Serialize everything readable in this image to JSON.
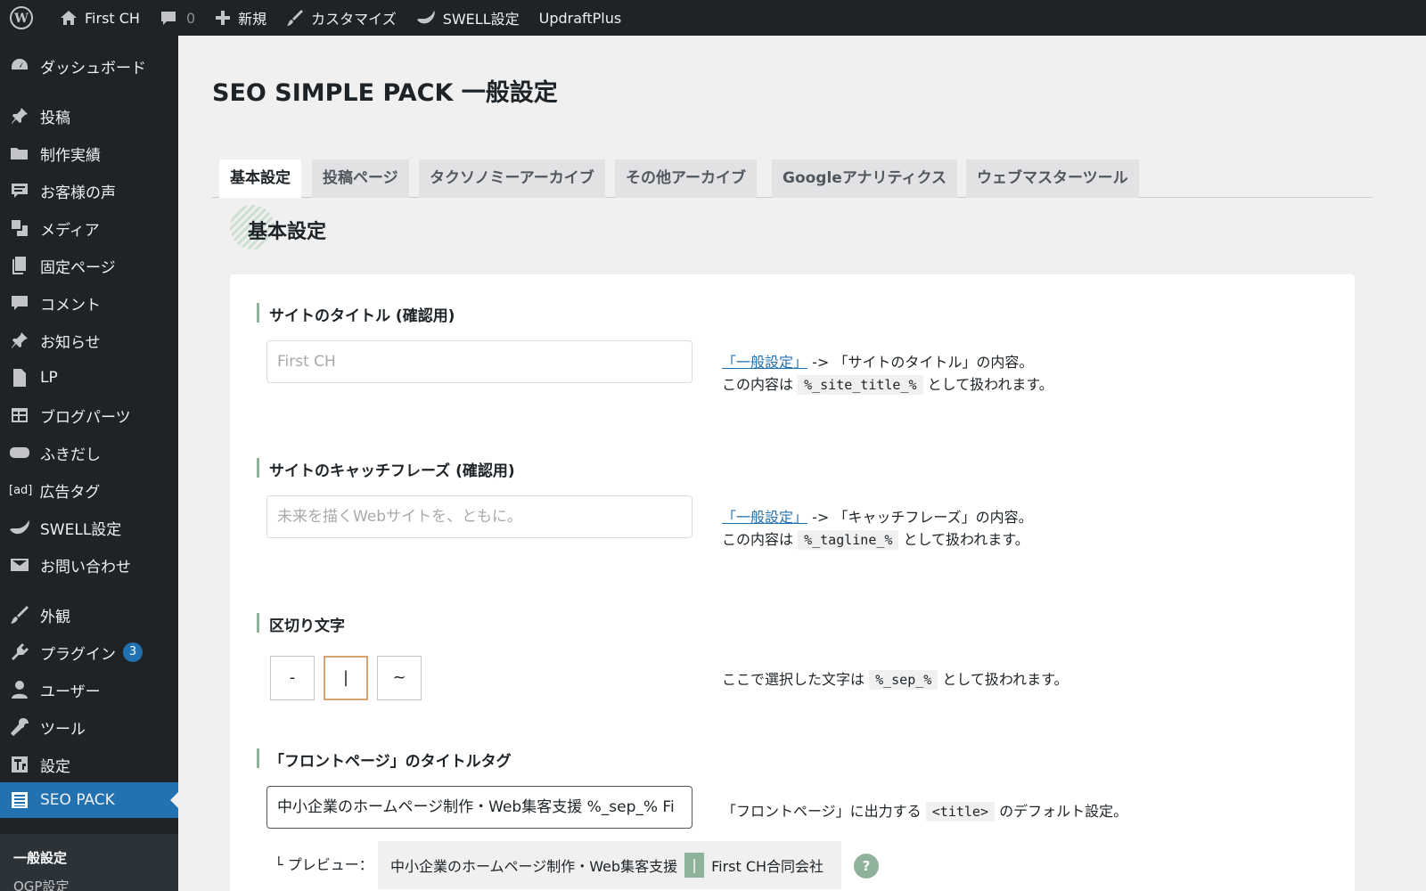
{
  "admin_bar": {
    "site_name": "First CH",
    "comments_count": "0",
    "new_label": "新規",
    "customize_label": "カスタマイズ",
    "swell_label": "SWELL設定",
    "updraft_label": "UpdraftPlus"
  },
  "sidebar": {
    "items": [
      {
        "label": "ダッシュボード",
        "icon": "dashboard-icon"
      },
      {
        "label": "投稿",
        "icon": "pin-icon"
      },
      {
        "label": "制作実績",
        "icon": "folder-icon"
      },
      {
        "label": "お客様の声",
        "icon": "comment-lines-icon"
      },
      {
        "label": "メディア",
        "icon": "media-icon"
      },
      {
        "label": "固定ページ",
        "icon": "pages-icon"
      },
      {
        "label": "コメント",
        "icon": "comment-icon"
      },
      {
        "label": "お知らせ",
        "icon": "pin-icon"
      },
      {
        "label": "LP",
        "icon": "page-icon"
      },
      {
        "label": "ブログパーツ",
        "icon": "table-icon"
      },
      {
        "label": "ふきだし",
        "icon": "bubble-icon"
      },
      {
        "label": "広告タグ",
        "icon": "ad-icon",
        "icon_text": "[ad]"
      },
      {
        "label": "SWELL設定",
        "icon": "swell-icon"
      },
      {
        "label": "お問い合わせ",
        "icon": "mail-icon"
      },
      {
        "label": "外観",
        "icon": "brush-icon"
      },
      {
        "label": "プラグイン",
        "icon": "plugin-icon",
        "badge": "3"
      },
      {
        "label": "ユーザー",
        "icon": "user-icon"
      },
      {
        "label": "ツール",
        "icon": "wrench-icon"
      },
      {
        "label": "設定",
        "icon": "settings-icon"
      },
      {
        "label": "SEO PACK",
        "icon": "list-icon",
        "current": true
      }
    ],
    "submenu": {
      "active": "一般設定",
      "next": "OGP設定"
    }
  },
  "page": {
    "title": "SEO SIMPLE PACK 一般設定",
    "tabs": [
      "基本設定",
      "投稿ページ",
      "タクソノミーアーカイブ",
      "その他アーカイブ",
      "Googleアナリティクス",
      "ウェブマスターツール"
    ],
    "active_tab": 0,
    "section_title": "基本設定"
  },
  "fields": {
    "site_title": {
      "label": "サイトのタイトル (確認用)",
      "value": "First CH",
      "desc_link": "「一般設定」",
      "desc_line1": " -> 「サイトのタイトル」の内容。",
      "desc_line2_pre": "この内容は ",
      "desc_code": "%_site_title_%",
      "desc_line2_post": " として扱われます。"
    },
    "tagline": {
      "label": "サイトのキャッチフレーズ (確認用)",
      "value": "未来を描くWebサイトを、ともに。",
      "desc_link": "「一般設定」",
      "desc_line1": " -> 「キャッチフレーズ」の内容。",
      "desc_line2_pre": "この内容は ",
      "desc_code": "%_tagline_%",
      "desc_line2_post": " として扱われます。"
    },
    "separator": {
      "label": "区切り文字",
      "options": [
        "-",
        "|",
        "~"
      ],
      "selected": 1,
      "desc_pre": "ここで選択した文字は ",
      "desc_code": "%_sep_%",
      "desc_post": " として扱われます。"
    },
    "front_title": {
      "label": "「フロントページ」のタイトルタグ",
      "value": "中小企業のホームページ制作・Web集客支援 %_sep_% Fi",
      "desc_pre": "「フロントページ」に出力する ",
      "desc_code": "<title>",
      "desc_post": " のデフォルト設定。",
      "preview_label": "└ プレビュー：",
      "preview_main": "中小企業のホームページ制作・Web集客支援",
      "preview_sep": "|",
      "preview_site": "First CH合同会社",
      "help": "?"
    }
  },
  "colors": {
    "admin_dark": "#1d2327",
    "accent_blue": "#2271b1",
    "accent_green": "#8fb39a",
    "selected_orange": "#d9a273"
  }
}
